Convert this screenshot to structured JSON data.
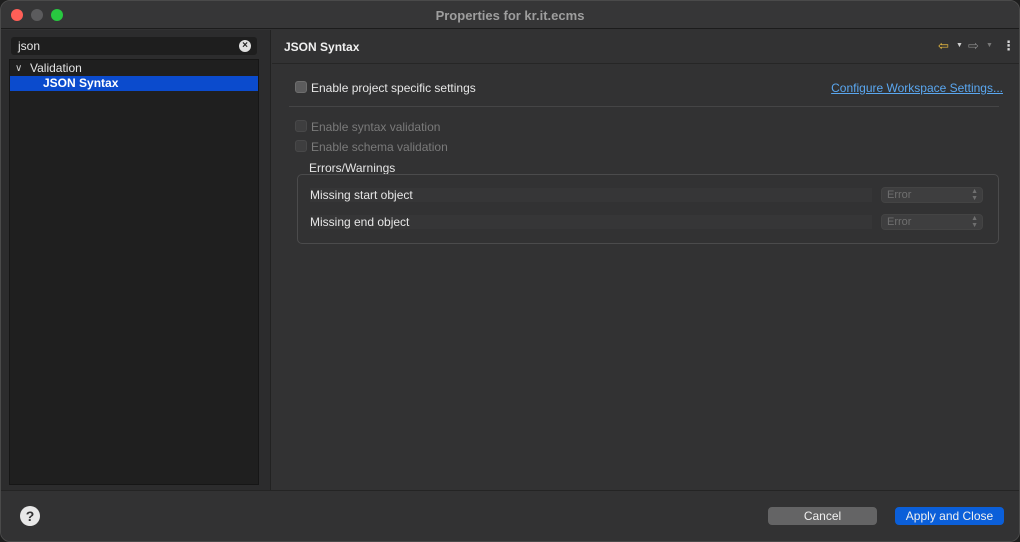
{
  "window": {
    "title": "Properties for kr.it.ecms"
  },
  "left": {
    "filter_value": "json",
    "tree": [
      {
        "label": "Validation",
        "expanded": true
      },
      {
        "label": "JSON Syntax",
        "selected": true
      }
    ]
  },
  "page": {
    "title": "JSON Syntax",
    "enable_project_label": "Enable project specific settings",
    "configure_link": "Configure Workspace Settings...",
    "enable_syntax_label": "Enable syntax validation",
    "enable_schema_label": "Enable schema validation",
    "group_label": "Errors/Warnings",
    "rows": [
      {
        "label": "Missing start object",
        "value": "Error"
      },
      {
        "label": "Missing end object",
        "value": "Error"
      }
    ]
  },
  "footer": {
    "cancel_label": "Cancel",
    "apply_label": "Apply and Close",
    "help_glyph": "?"
  },
  "icons": {
    "back": "arrow-left-icon",
    "forward": "arrow-right-icon",
    "menu": "vertical-ellipsis-icon",
    "help": "help-icon"
  },
  "colors": {
    "accent": "#0b5fd9",
    "selection": "#0b4bcd",
    "link": "#5aa7f0"
  }
}
